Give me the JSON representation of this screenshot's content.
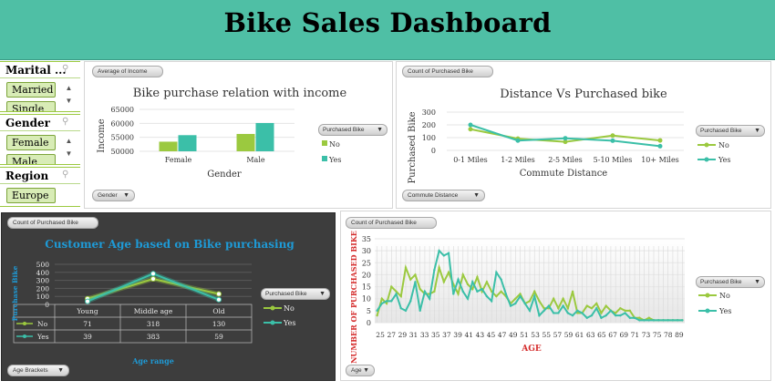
{
  "header": {
    "title": "Bike Sales Dashboard"
  },
  "slicers": [
    {
      "title": "Marital ...",
      "items": [
        "Married",
        "Single"
      ]
    },
    {
      "title": "Gender",
      "items": [
        "Female",
        "Male"
      ]
    },
    {
      "title": "Region",
      "items": [
        "Europe"
      ]
    }
  ],
  "income_panel": {
    "field_button": "Average of Income",
    "axis_button": "Gender",
    "legend_button": "Purchased Bike",
    "legend_no": "No",
    "legend_yes": "Yes"
  },
  "distance_panel": {
    "field_button": "Count of Purchased Bike",
    "axis_button": "Commute Distance",
    "legend_button": "Purchased Bike",
    "legend_no": "No",
    "legend_yes": "Yes"
  },
  "age_bracket_panel": {
    "field_button": "Count of Purchased Bike",
    "axis_button": "Age Brackets",
    "legend_button": "Purchased Bike",
    "legend_no": "No",
    "legend_yes": "Yes"
  },
  "age_panel": {
    "field_button": "Count of Purchased Bike",
    "axis_button": "Age",
    "legend_button": "Purchased Bike",
    "legend_no": "No",
    "legend_yes": "Yes"
  },
  "colors": {
    "no": "#9bc93f",
    "yes": "#3bbfa8",
    "header": "#4fbfa5",
    "dark_panel": "#3d3d3d",
    "age_title": "#1e9ad6",
    "age_axis": "#d42a2a"
  },
  "chart_data": [
    {
      "type": "bar",
      "title": "Bike purchase relation with income",
      "xlabel": "Gender",
      "ylabel": "Income",
      "categories": [
        "Female",
        "Male"
      ],
      "series": [
        {
          "name": "No",
          "values": [
            53440,
            56208
          ]
        },
        {
          "name": "Yes",
          "values": [
            55774,
            60124
          ]
        }
      ],
      "ylim": [
        50000,
        65000
      ],
      "yticks": [
        50000,
        55000,
        60000,
        65000
      ]
    },
    {
      "type": "line",
      "title": "Distance  Vs Purchased bike",
      "xlabel": "Commute Distance",
      "ylabel": "Purchased Bike",
      "categories": [
        "0-1 Miles",
        "1-2 Miles",
        "2-5 Miles",
        "5-10 Miles",
        "10+ Miles"
      ],
      "series": [
        {
          "name": "No",
          "values": [
            166,
            92,
            67,
            116,
            78
          ]
        },
        {
          "name": "Yes",
          "values": [
            200,
            77,
            95,
            76,
            33
          ]
        }
      ],
      "ylim": [
        0,
        300
      ],
      "yticks": [
        0,
        100,
        200,
        300
      ]
    },
    {
      "type": "line",
      "title": "Customer Age based on Bike purchasing",
      "xlabel": "Age range",
      "ylabel": "Purchase Bike",
      "categories": [
        "Young",
        "Middle age",
        "Old"
      ],
      "series": [
        {
          "name": "No",
          "values": [
            71,
            318,
            130
          ]
        },
        {
          "name": "Yes",
          "values": [
            39,
            383,
            59
          ]
        }
      ],
      "ylim": [
        0,
        500
      ],
      "yticks": [
        0,
        100,
        200,
        300,
        400,
        500
      ]
    },
    {
      "type": "line",
      "xlabel": "AGE",
      "ylabel": "NUMBER OF PURCHASED BIKE",
      "x": [
        25,
        26,
        27,
        28,
        29,
        30,
        31,
        32,
        33,
        34,
        35,
        36,
        37,
        38,
        39,
        40,
        41,
        42,
        43,
        44,
        45,
        46,
        47,
        48,
        49,
        50,
        51,
        52,
        53,
        54,
        55,
        56,
        57,
        58,
        59,
        60,
        61,
        62,
        63,
        64,
        65,
        66,
        67,
        68,
        69,
        70,
        71,
        72,
        73,
        74,
        75,
        76,
        77,
        78,
        79,
        80,
        81,
        82,
        83,
        84,
        85,
        86,
        87,
        88,
        89
      ],
      "xticklabels": [
        "25",
        "27",
        "29",
        "31",
        "33",
        "35",
        "37",
        "39",
        "41",
        "43",
        "45",
        "47",
        "49",
        "51",
        "53",
        "55",
        "57",
        "59",
        "61",
        "63",
        "65",
        "67",
        "69",
        "71",
        "73",
        "75",
        "78",
        "89"
      ],
      "series": [
        {
          "name": "No",
          "values": [
            3,
            10,
            8,
            15,
            13,
            11,
            23,
            18,
            20,
            14,
            12,
            12,
            13,
            23,
            17,
            21,
            16,
            12,
            20,
            16,
            14,
            19,
            13,
            17,
            13,
            11,
            13,
            11,
            8,
            10,
            12,
            8,
            9,
            13,
            9,
            6,
            6,
            10,
            6,
            10,
            6,
            13,
            4,
            4,
            7,
            6,
            8,
            4,
            7,
            5,
            4,
            6,
            5,
            5,
            2,
            2,
            1,
            2,
            1,
            1,
            1,
            1,
            1,
            1,
            1
          ]
        },
        {
          "name": "Yes",
          "values": [
            5,
            8,
            9,
            9,
            12,
            6,
            5,
            9,
            17,
            5,
            13,
            10,
            22,
            30,
            28,
            29,
            12,
            18,
            13,
            10,
            17,
            13,
            14,
            11,
            9,
            21,
            18,
            12,
            7,
            8,
            11,
            8,
            5,
            11,
            3,
            5,
            7,
            4,
            4,
            7,
            4,
            3,
            5,
            4,
            2,
            3,
            6,
            2,
            3,
            5,
            3,
            3,
            4,
            2,
            2,
            1,
            1,
            1,
            1,
            1,
            1,
            1,
            1,
            1,
            1
          ]
        }
      ],
      "ylim": [
        0,
        35
      ],
      "yticks": [
        0,
        5,
        10,
        15,
        20,
        25,
        30,
        35
      ]
    }
  ]
}
